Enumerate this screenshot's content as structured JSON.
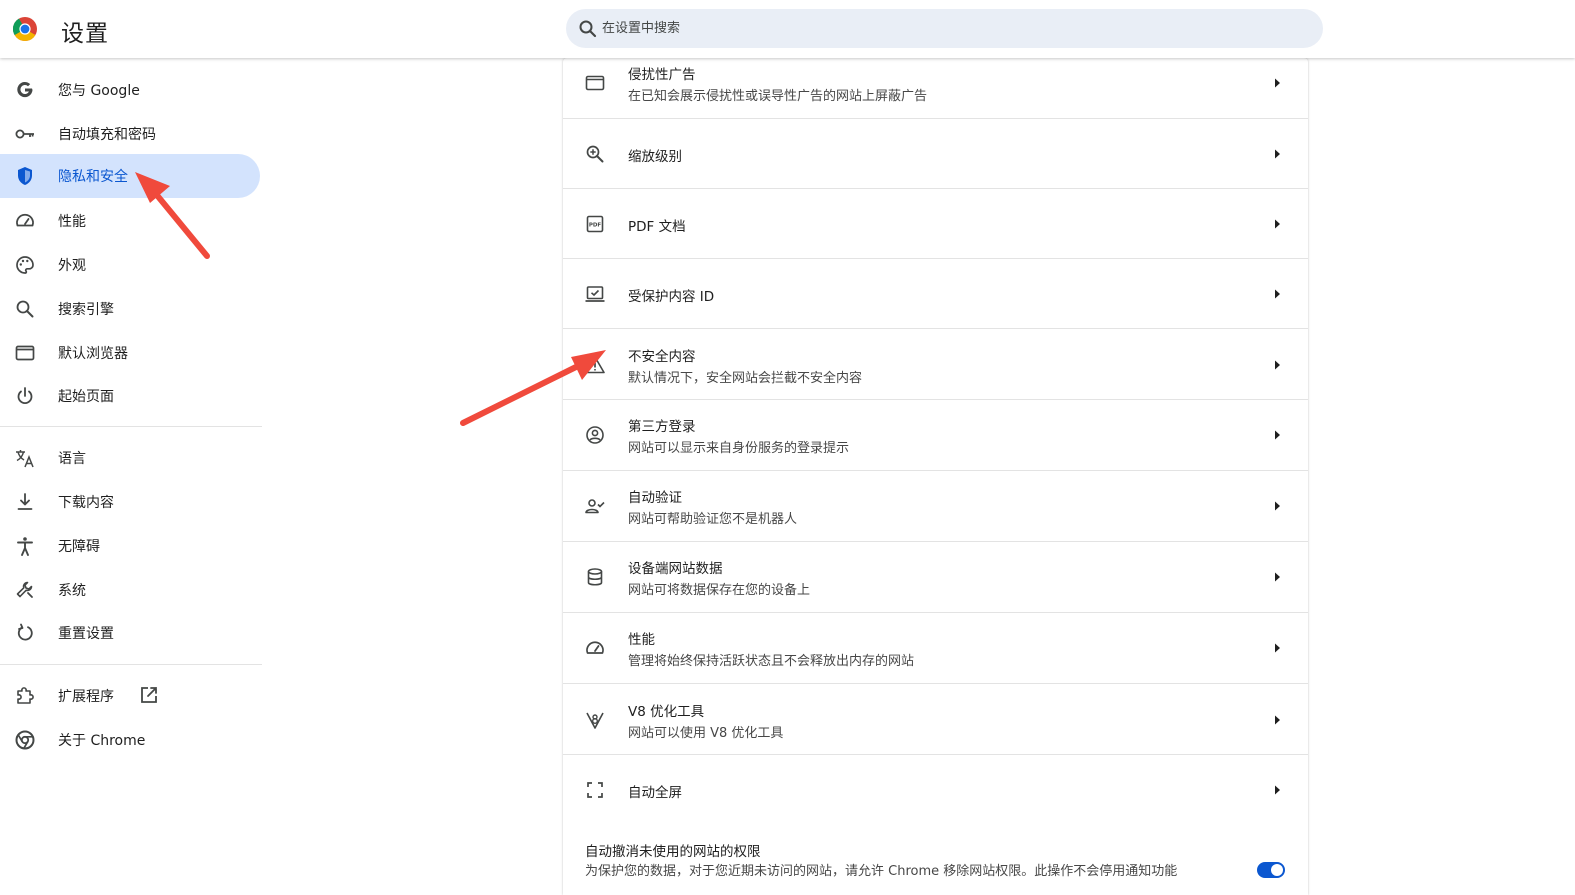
{
  "header": {
    "title": "设置",
    "search_placeholder": "在设置中搜索"
  },
  "sidebar": {
    "items": [
      {
        "label": "您与 Google",
        "icon": "google-g-icon"
      },
      {
        "label": "自动填充和密码",
        "icon": "key-icon"
      },
      {
        "label": "隐私和安全",
        "icon": "shield-icon",
        "active": true
      },
      {
        "label": "性能",
        "icon": "speedometer-icon"
      },
      {
        "label": "外观",
        "icon": "palette-icon"
      },
      {
        "label": "搜索引擎",
        "icon": "search-icon"
      },
      {
        "label": "默认浏览器",
        "icon": "browser-window-icon"
      },
      {
        "label": "起始页面",
        "icon": "power-icon"
      },
      {
        "label": "语言",
        "icon": "translate-icon"
      },
      {
        "label": "下载内容",
        "icon": "download-icon"
      },
      {
        "label": "无障碍",
        "icon": "accessibility-icon"
      },
      {
        "label": "系统",
        "icon": "wrench-icon"
      },
      {
        "label": "重置设置",
        "icon": "reset-icon"
      },
      {
        "label": "扩展程序",
        "icon": "puzzle-icon"
      },
      {
        "label": "关于 Chrome",
        "icon": "chrome-icon"
      }
    ]
  },
  "settings_rows": [
    {
      "title": "侵扰性广告",
      "subtitle": "在已知会展示侵扰性或误导性广告的网站上屏蔽广告",
      "icon": "ads-window-icon"
    },
    {
      "title": "缩放级别",
      "subtitle": "",
      "icon": "zoom-in-icon"
    },
    {
      "title": "PDF 文档",
      "subtitle": "",
      "icon": "pdf-icon"
    },
    {
      "title": "受保护内容 ID",
      "subtitle": "",
      "icon": "protected-content-icon"
    },
    {
      "title": "不安全内容",
      "subtitle": "默认情况下，安全网站会拦截不安全内容",
      "icon": "warning-icon"
    },
    {
      "title": "第三方登录",
      "subtitle": "网站可以显示来自身份服务的登录提示",
      "icon": "account-circle-icon"
    },
    {
      "title": "自动验证",
      "subtitle": "网站可帮助验证您不是机器人",
      "icon": "person-check-icon"
    },
    {
      "title": "设备端网站数据",
      "subtitle": "网站可将数据保存在您的设备上",
      "icon": "database-icon"
    },
    {
      "title": "性能",
      "subtitle": "管理将始终保持活跃状态且不会释放出内存的网站",
      "icon": "speedometer-icon"
    },
    {
      "title": "V8 优化工具",
      "subtitle": "网站可以使用 V8 优化工具",
      "icon": "v8-bug-icon"
    },
    {
      "title": "自动全屏",
      "subtitle": "",
      "icon": "fullscreen-icon"
    }
  ],
  "revoke_permissions": {
    "title": "自动撤消未使用的网站的权限",
    "description": "为保护您的数据，对于您近期未访问的网站，请允许 Chrome 移除网站权限。此操作不会停用通知功能",
    "enabled": true
  },
  "colors": {
    "accent": "#0b57d0",
    "active_nav_bg": "#d3e3fd",
    "search_bg": "#e9eef6",
    "annotation_arrow": "#f04a3c"
  }
}
